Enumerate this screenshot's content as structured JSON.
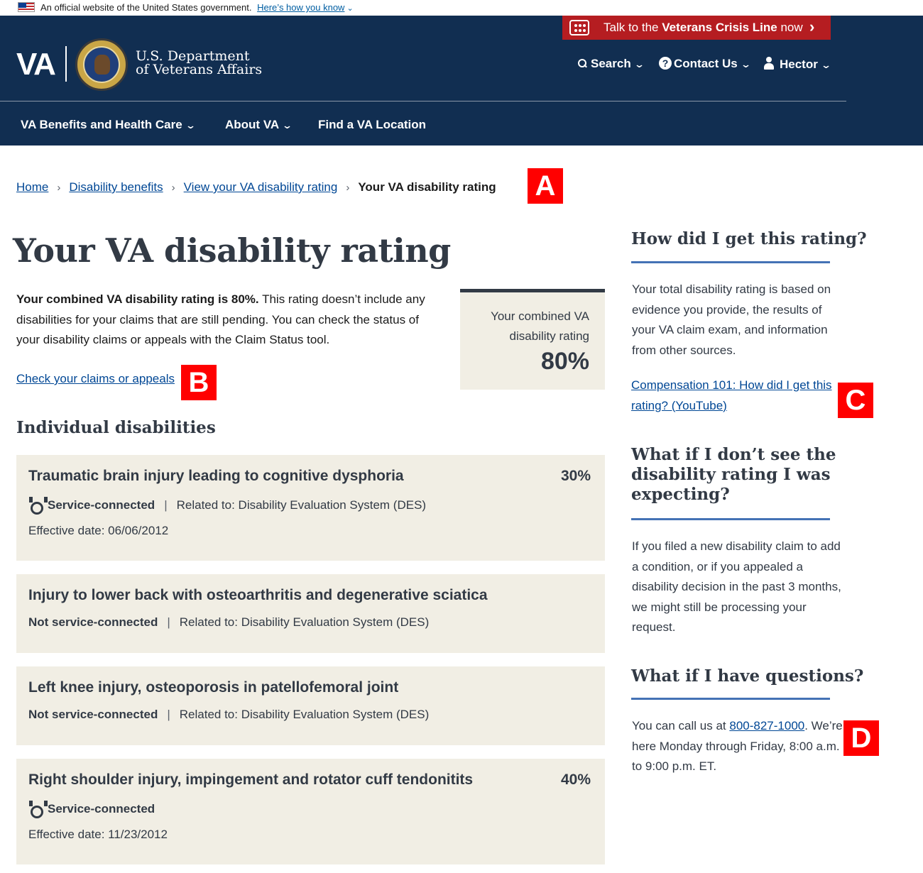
{
  "gov_banner": {
    "text": "An official website of the United States government.",
    "link": "Here’s how you know"
  },
  "crisis_line": {
    "prefix": "Talk to the ",
    "strong": "Veterans Crisis Line",
    "suffix": " now"
  },
  "header": {
    "logo": "VA",
    "dept_line1": "U.S. Department",
    "dept_line2": "of Veterans Affairs",
    "search": "Search",
    "contact": "Contact Us",
    "user": "Hector"
  },
  "nav": {
    "benefits": "VA Benefits and Health Care",
    "about": "About VA",
    "location": "Find a VA Location"
  },
  "breadcrumb": {
    "home": "Home",
    "disability": "Disability benefits",
    "view_rating": "View your VA disability rating",
    "current": "Your VA disability rating"
  },
  "markers": {
    "a": "A",
    "b": "B",
    "c": "C",
    "d": "D"
  },
  "main": {
    "title": "Your VA disability rating",
    "intro_bold": "Your combined VA disability rating is 80%.",
    "intro_rest": " This rating doesn’t include any disabilities for your claims that are still pending. You can check the status of your disability claims or appeals with the Claim Status tool.",
    "claims_link": "Check your claims or appeals",
    "rating_label": "Your combined VA disability rating",
    "rating_value": "80%",
    "individual_heading": "Individual disabilities"
  },
  "disabilities": [
    {
      "name": "Traumatic brain injury leading to cognitive dysphoria",
      "percent": "30%",
      "status": "Service-connected",
      "related": "Related to: Disability Evaluation System (DES)",
      "effective": "Effective date: 06/06/2012"
    },
    {
      "name": "Injury to lower back with osteoarthritis and degenerative sciatica",
      "status": "Not service-connected",
      "related": "Related to: Disability Evaluation System (DES)"
    },
    {
      "name": "Left knee injury, osteoporosis in patellofemoral joint",
      "status": "Not service-connected",
      "related": "Related to: Disability Evaluation System (DES)"
    },
    {
      "name": "Right shoulder injury, impingement and rotator cuff tendonitits",
      "percent": "40%",
      "status": "Service-connected",
      "effective": "Effective date: 11/23/2012"
    }
  ],
  "sidebar": {
    "how_heading": "How did I get this rating?",
    "how_text": "Your total disability rating is based on evidence you provide, the results of your VA claim exam, and information from other sources.",
    "how_link": "Compensation 101: How did I get this rating? (YouTube)",
    "missing_heading": "What if I don’t see the disability rating I was expecting?",
    "missing_text": "If you filed a new disability claim to add a condition, or if you appealed a disability decision in the past 3 months, we might still be processing your request.",
    "questions_heading": "What if I have questions?",
    "questions_pre": "You can call us at ",
    "questions_phone": "800-827-1000",
    "questions_post": ". We’re here Monday through Friday, 8:00 a.m. to 9:00 p.m. ET."
  }
}
